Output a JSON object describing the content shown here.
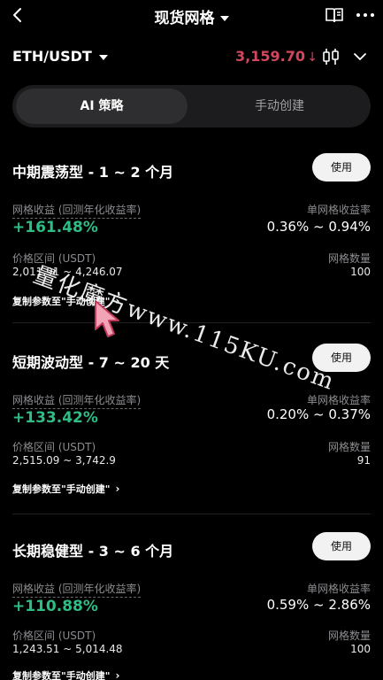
{
  "header": {
    "title": "现货网格"
  },
  "pair": {
    "name": "ETH/USDT",
    "price": "3,159.70",
    "price_arrow": "↓"
  },
  "tabs": [
    {
      "label": "AI 策略"
    },
    {
      "label": "手动创建"
    }
  ],
  "cards": [
    {
      "title": "中期震荡型 - 1 ~ 2 个月",
      "use_label": "使用",
      "return_label": "网格收益 (回测年化收益率)",
      "return_value": "+161.48%",
      "rate_label": "单网格收益率",
      "rate_value": "0.36% ~ 0.94%",
      "range_label": "价格区间 (USDT)",
      "range_value": "2,011.91 ~ 4,246.07",
      "count_label": "网格数量",
      "count_value": "100",
      "copy_label": "复制参数至\"手动创建\""
    },
    {
      "title": "短期波动型 - 7 ~ 20 天",
      "use_label": "使用",
      "return_label": "网格收益 (回测年化收益率)",
      "return_value": "+133.42%",
      "rate_label": "单网格收益率",
      "rate_value": "0.20% ~ 0.37%",
      "range_label": "价格区间 (USDT)",
      "range_value": "2,515.09 ~ 3,742.9",
      "count_label": "网格数量",
      "count_value": "91",
      "copy_label": "复制参数至\"手动创建\""
    },
    {
      "title": "长期稳健型 - 3 ~ 6 个月",
      "use_label": "使用",
      "return_label": "网格收益 (回测年化收益率)",
      "return_value": "+110.88%",
      "rate_label": "单网格收益率",
      "rate_value": "0.59% ~ 2.86%",
      "range_label": "价格区间 (USDT)",
      "range_value": "1,243.51 ~ 5,014.48",
      "count_label": "网格数量",
      "count_value": "100",
      "copy_label": "复制参数至\"手动创建\""
    }
  ],
  "watermark": {
    "text": "量化魔方www.115KU.com"
  },
  "colors": {
    "background": "#000000",
    "positive": "#2ebd85",
    "negative": "#d2465e",
    "tab_bg": "#1c1c1e",
    "button_bg": "#f2f2f2"
  },
  "icons": [
    "back-arrow-icon",
    "caret-down-icon",
    "book-icon",
    "more-dots-icon",
    "candlestick-icon",
    "chevron-down-icon",
    "chevron-right-icon",
    "cursor-icon"
  ]
}
